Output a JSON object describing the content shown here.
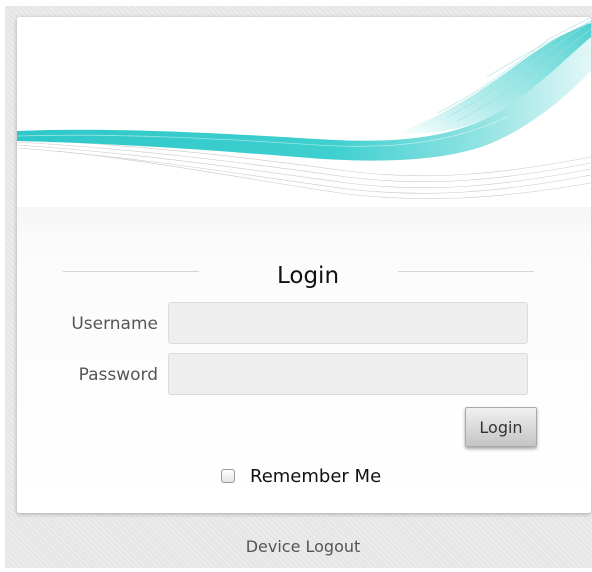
{
  "login_form": {
    "title": "Login",
    "username_label": "Username",
    "username_value": "",
    "password_label": "Password",
    "password_value": "",
    "login_button_label": "Login",
    "remember_me_label": "Remember Me",
    "remember_me_checked": false
  },
  "footer": {
    "device_logout_label": "Device Logout"
  },
  "colors": {
    "accent_teal": "#2ec8c8",
    "page_background": "#e6e6e6",
    "card_background": "#ffffff",
    "button_gradient_top": "#f1f1f1",
    "button_gradient_bottom": "#c4c4c4"
  }
}
